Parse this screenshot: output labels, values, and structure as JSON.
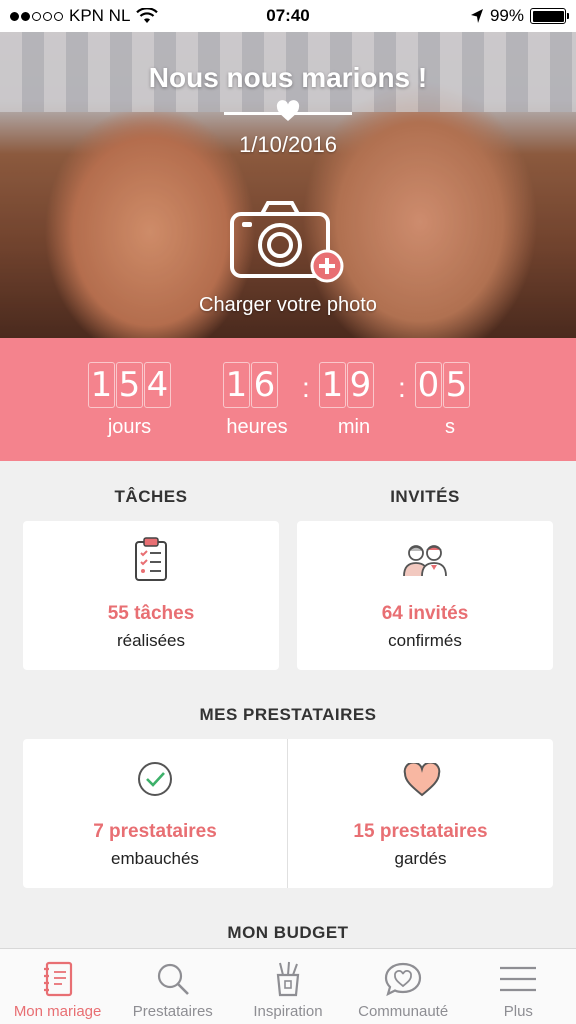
{
  "status_bar": {
    "carrier": "KPN NL",
    "time": "07:40",
    "battery": "99%",
    "icons": [
      "signal-dots-icon",
      "wifi-icon",
      "location-arrow-icon",
      "battery-icon"
    ]
  },
  "hero": {
    "title": "Nous nous marions !",
    "date": "1/10/2016",
    "upload_label": "Charger votre photo",
    "icons": [
      "heart-icon",
      "camera-add-icon"
    ]
  },
  "countdown": {
    "days": [
      "1",
      "5",
      "4"
    ],
    "hours": [
      "1",
      "6"
    ],
    "minutes": [
      "1",
      "9"
    ],
    "seconds": [
      "0",
      "5"
    ],
    "labels": {
      "days": "jours",
      "hours": "heures",
      "minutes": "min",
      "seconds": "s"
    }
  },
  "tasks": {
    "heading": "TÂCHES",
    "count": "55 tâches",
    "status": "réalisées",
    "icon": "clipboard-checklist-icon"
  },
  "guests": {
    "heading": "INVITÉS",
    "count": "64 invités",
    "status": "confirmés",
    "icon": "couple-icon"
  },
  "vendors": {
    "heading": "MES PRESTATAIRES",
    "hired": {
      "count": "7 prestataires",
      "status": "embauchés",
      "icon": "check-circle-icon"
    },
    "saved": {
      "count": "15 prestataires",
      "status": "gardés",
      "icon": "heart-icon"
    }
  },
  "budget": {
    "heading": "MON BUDGET"
  },
  "tabbar": {
    "items": [
      {
        "label": "Mon mariage",
        "icon": "notebook-icon",
        "active": true
      },
      {
        "label": "Prestataires",
        "icon": "search-icon",
        "active": false
      },
      {
        "label": "Inspiration",
        "icon": "paint-cup-icon",
        "active": false
      },
      {
        "label": "Communauté",
        "icon": "chat-heart-icon",
        "active": false
      },
      {
        "label": "Plus",
        "icon": "menu-icon",
        "active": false
      }
    ]
  },
  "colors": {
    "accent": "#f4838d",
    "accent_text": "#e86f73",
    "background": "#f0f0f0",
    "check_green": "#3db16a",
    "heart_fill": "#f8b7a2"
  }
}
